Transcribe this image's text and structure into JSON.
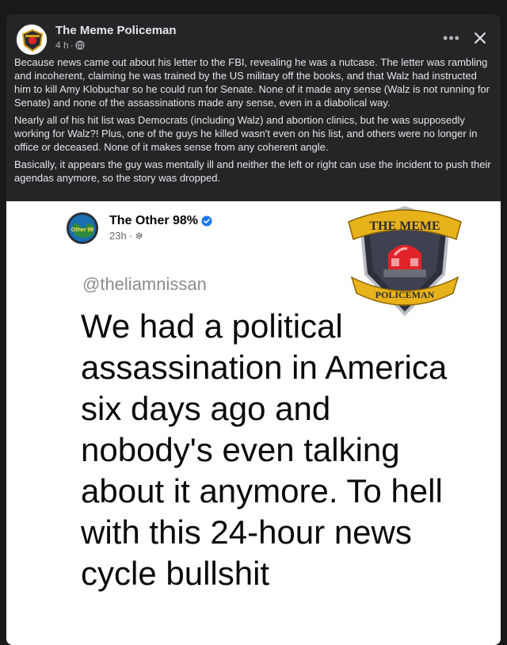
{
  "post": {
    "author": "The Meme Policeman",
    "time": "4 h",
    "paragraphs": [
      "Because news came out about his letter to the FBI, revealing he was a nutcase. The letter was rambling and incoherent, claiming he was trained by the US military off the books, and that Walz had instructed him to kill Amy Klobuchar so he could run for Senate. None of it made any sense (Walz is not running for Senate) and none of the assassinations made any sense, even in a diabolical way.",
      "Nearly all of his hit list was Democrats (including Walz) and abortion clinics, but he was supposedly working for Walz?! Plus, one of the guys he killed wasn't even on his list, and others were no longer in office or deceased. None of it makes sense from any coherent angle.",
      "Basically, it appears the guy was mentally ill and neither the left or right can use the incident to push their agendas anymore, so the story was dropped."
    ],
    "more_label": "•••",
    "close_label": "✕"
  },
  "shared": {
    "author": "The Other 98%",
    "time": "23h",
    "handle": "@theliamnissan",
    "quote": "We had a political assassination in America six days ago and nobody's even talking about it anymore. To hell with this 24-hour news cycle bullshit",
    "avatar_text": "Other 98"
  },
  "watermark": {
    "top_text": "THE MEME",
    "bottom_text": "POLICEMAN"
  },
  "colors": {
    "card_bg": "#242526",
    "page_bg": "#18191a",
    "verified": "#1877f2",
    "badge_gold": "#d4a017",
    "siren_red": "#e0242a"
  },
  "icons": [
    "globe-icon",
    "more-icon",
    "close-icon",
    "verified-icon",
    "siren-icon"
  ]
}
